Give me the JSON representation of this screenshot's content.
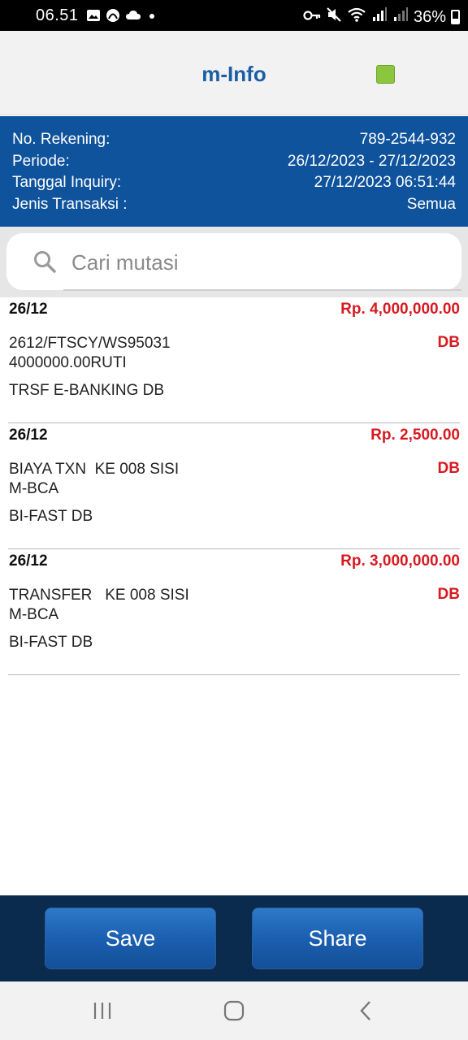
{
  "status_bar": {
    "time": "06.51",
    "battery": "36%",
    "left_icons": [
      "image-icon",
      "app-icon",
      "cloud-icon",
      "dot-icon"
    ],
    "right_icons": [
      "key-icon",
      "mute-icon",
      "wifi-icon",
      "signal-icon",
      "signal-icon",
      "battery-icon"
    ]
  },
  "header": {
    "title": "m-Info",
    "status_color": "#8cc63f"
  },
  "info": {
    "rows": [
      {
        "label": "No. Rekening:",
        "value": "789-2544-932"
      },
      {
        "label": "Periode:",
        "value": "26/12/2023 - 27/12/2023"
      },
      {
        "label": "Tanggal Inquiry:",
        "value": "27/12/2023 06:51:44"
      },
      {
        "label": "Jenis Transaksi :",
        "value": "Semua"
      }
    ]
  },
  "search": {
    "placeholder": "Cari mutasi",
    "value": ""
  },
  "transactions": [
    {
      "date": "26/12",
      "amount": "Rp. 4,000,000.00",
      "description": "2612/FTSCY/WS95031\n4000000.00RUTI",
      "type": "DB",
      "channel": "TRSF E-BANKING DB"
    },
    {
      "date": "26/12",
      "amount": "Rp. 2,500.00",
      "description": "BIAYA TXN  KE 008 SISI\nM-BCA",
      "type": "DB",
      "channel": "BI-FAST DB"
    },
    {
      "date": "26/12",
      "amount": "Rp. 3,000,000.00",
      "description": "TRANSFER   KE 008 SISI\nM-BCA",
      "type": "DB",
      "channel": "BI-FAST DB"
    }
  ],
  "actions": {
    "save_label": "Save",
    "share_label": "Share"
  },
  "colors": {
    "accent": "#0f539c",
    "title": "#1b5ea6",
    "amount": "#d71920",
    "action_bar": "#0a2a4e"
  }
}
